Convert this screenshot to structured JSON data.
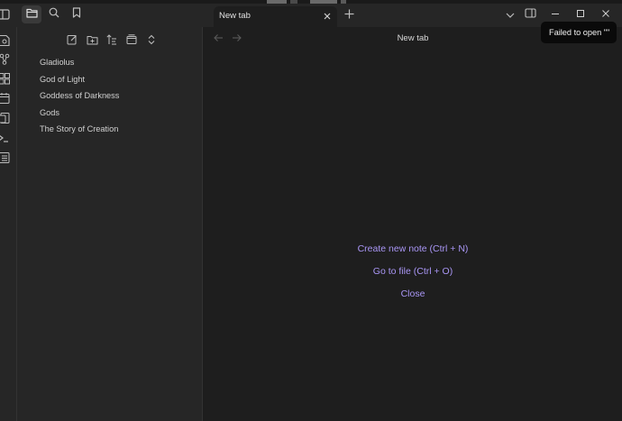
{
  "tab": {
    "title": "New tab"
  },
  "view": {
    "title": "New tab"
  },
  "files": [
    "Gladiolus",
    "God of Light",
    "Goddess of Darkness",
    "Gods",
    "The Story of Creation"
  ],
  "empty_state": {
    "create_note": "Create new note (Ctrl + N)",
    "go_to_file": "Go to file (Ctrl + O)",
    "close": "Close"
  },
  "tooltip": {
    "text": "Failed to open \"\""
  },
  "colors": {
    "accent": "#a996f5",
    "background": "#1e1e1e",
    "sidebar": "#262626"
  }
}
